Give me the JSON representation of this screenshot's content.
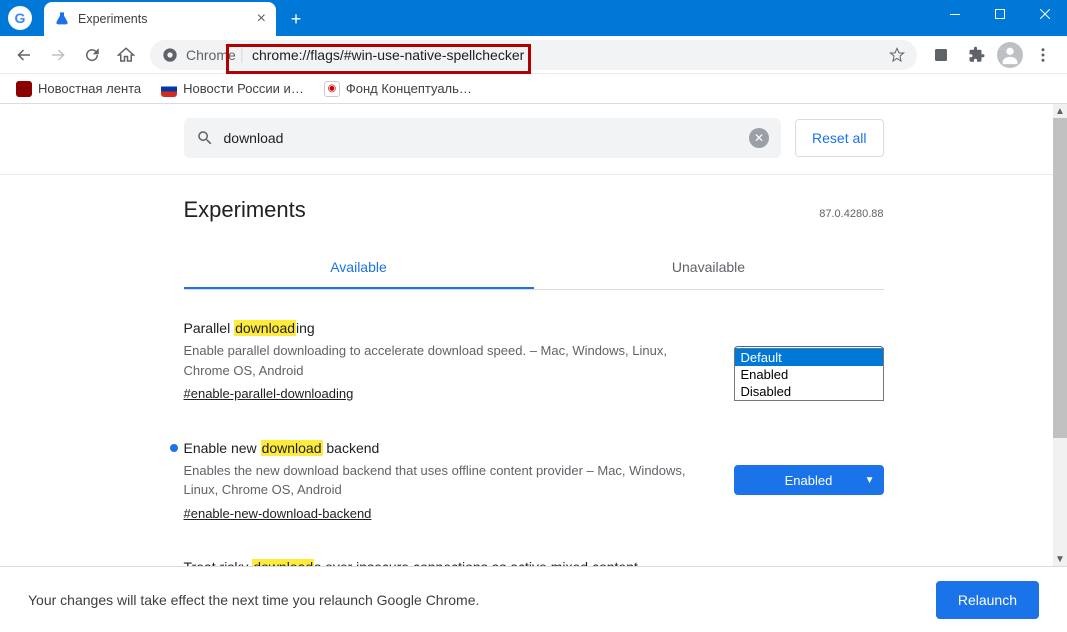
{
  "window": {
    "tab_title": "Experiments"
  },
  "toolbar": {
    "chip": "Chrome",
    "url": "chrome://flags/#win-use-native-spellchecker"
  },
  "bookmarks": [
    {
      "label": "Новостная лента"
    },
    {
      "label": "Новости России и…"
    },
    {
      "label": "Фонд Концептуаль…"
    }
  ],
  "search": {
    "query": "download",
    "reset": "Reset all"
  },
  "page": {
    "title": "Experiments",
    "version": "87.0.4280.88",
    "tab_available": "Available",
    "tab_unavailable": "Unavailable"
  },
  "flags": [
    {
      "title_pre": "Parallel ",
      "title_hl": "download",
      "title_post": "ing",
      "desc": "Enable parallel downloading to accelerate download speed. – Mac, Windows, Linux, Chrome OS, Android",
      "hash": "#enable-parallel-downloading",
      "selected": "Default",
      "dot": false,
      "dropdown_open": true,
      "options": [
        "Default",
        "Enabled",
        "Disabled"
      ],
      "filled": false
    },
    {
      "title_pre": "Enable new ",
      "title_hl": "download",
      "title_post": " backend",
      "desc": "Enables the new download backend that uses offline content provider – Mac, Windows, Linux, Chrome OS, Android",
      "hash": "#enable-new-download-backend",
      "selected": "Enabled",
      "dot": true,
      "dropdown_open": false,
      "filled": true
    },
    {
      "title_pre": "Treat risky ",
      "title_hl": "download",
      "title_post": "s over insecure connections as active mixed content",
      "desc": "",
      "hash": "",
      "selected": "",
      "dot": false,
      "dropdown_open": false,
      "filled": false
    }
  ],
  "bottom": {
    "msg": "Your changes will take effect the next time you relaunch Google Chrome.",
    "relaunch": "Relaunch"
  }
}
